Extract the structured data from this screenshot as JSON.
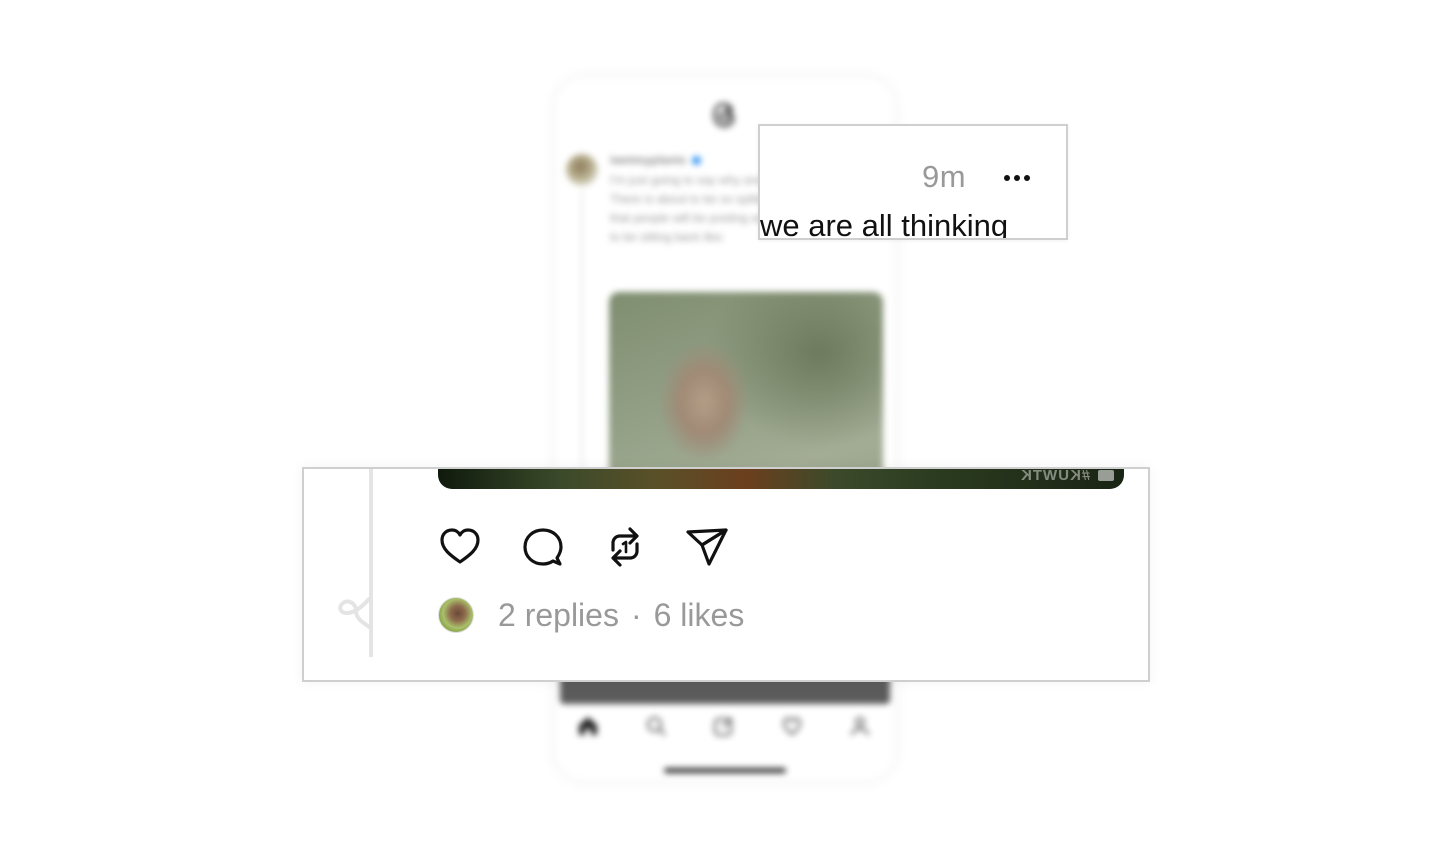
{
  "background_phone": {
    "username": "iwetmyplants",
    "post_text": "I'm just going to say why and knowing is about to There is about to be so spillage on here daily that people will be posting and we are all going to be sitting back like:",
    "image_watermark": "#KUWTK"
  },
  "zoom_top": {
    "timestamp": "9m",
    "more_icon": "more-horizontal-icon",
    "post_text_fragment": "we are all thinking"
  },
  "zoom_bottom": {
    "image_watermark": "#KUWTK",
    "actions": [
      {
        "name": "like",
        "icon": "heart-icon"
      },
      {
        "name": "reply",
        "icon": "comment-icon"
      },
      {
        "name": "repost",
        "icon": "repost-icon"
      },
      {
        "name": "share",
        "icon": "send-icon"
      }
    ],
    "replies": "2 replies",
    "separator": "·",
    "likes": "6 likes"
  },
  "colors": {
    "text_primary": "#111111",
    "text_secondary": "#999999",
    "thread_line": "#e4e4e4",
    "callout_border": "#cfcfcf"
  }
}
